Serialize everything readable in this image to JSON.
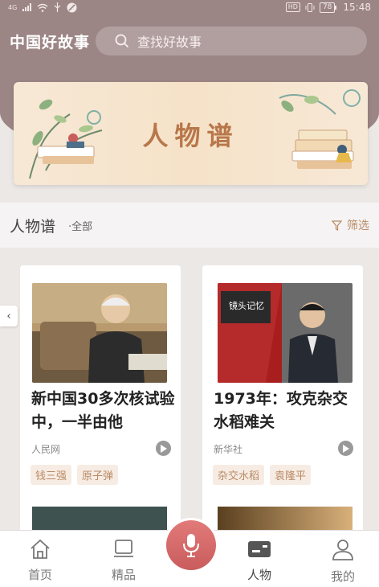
{
  "status_bar": {
    "network": "4G",
    "hd": "HD",
    "battery": "78",
    "time": "15:48"
  },
  "header": {
    "app_title": "中国好故事",
    "search_placeholder": "查找好故事"
  },
  "banner": {
    "title": "人物谱"
  },
  "section": {
    "title": "人物谱",
    "subtitle": "·全部",
    "filter_label": "筛选"
  },
  "cards": [
    {
      "title": "新中国30多次核试验中，一半由他",
      "source": "人民网",
      "tags": [
        "钱三强",
        "原子弹"
      ]
    },
    {
      "title": "1973年：攻克杂交水稻难关",
      "source": "新华社",
      "tags": [
        "杂交水稻",
        "袁隆平"
      ],
      "image_caption": "镜头记忆"
    }
  ],
  "bottom_nav": [
    {
      "label": "首页",
      "icon": "home-icon"
    },
    {
      "label": "精品",
      "icon": "premium-icon"
    },
    {
      "label": "",
      "icon": "microphone-icon"
    },
    {
      "label": "人物",
      "icon": "person-card-icon"
    },
    {
      "label": "我的",
      "icon": "user-icon"
    }
  ],
  "colors": {
    "header_bg": "#9c8585",
    "accent": "#b98b66",
    "mic": "#d56a6a",
    "active_nav": "#444444"
  }
}
